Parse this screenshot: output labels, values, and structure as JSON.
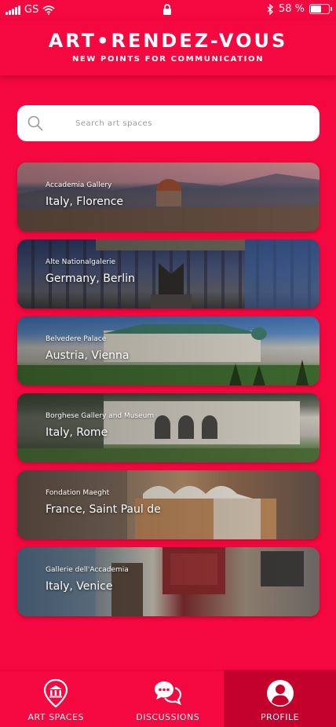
{
  "status_bar": {
    "carrier": "GS",
    "battery_text": "58 %",
    "battery_level": 0.58
  },
  "header": {
    "title": "ART•RENDEZ-VOUS",
    "subtitle": "NEW POINTS FOR COMMUNICATION"
  },
  "search": {
    "placeholder": "Search art spaces"
  },
  "cards": [
    {
      "name": "Accademia Gallery",
      "location": "Italy, Florence"
    },
    {
      "name": "Alte Nationalgalerie",
      "location": "Germany, Berlin"
    },
    {
      "name": "Belvedere Palace",
      "location": "Austria, Vienna"
    },
    {
      "name": "Borghese Gallery and Museum",
      "location": "Italy, Rome"
    },
    {
      "name": "Fondation Maeght",
      "location": "France, Saint Paul de"
    },
    {
      "name": "Gallerie dell'Accademia",
      "location": "Italy, Venice"
    }
  ],
  "nav": {
    "items": [
      {
        "label": "ART SPACES",
        "icon": "museum-pin-icon"
      },
      {
        "label": "DISCUSSIONS",
        "icon": "chat-bubbles-icon"
      },
      {
        "label": "PROFILE",
        "icon": "user-icon"
      }
    ],
    "active": "PROFILE"
  },
  "colors": {
    "background": "#f5073f",
    "active_tab": "#c4002c"
  }
}
